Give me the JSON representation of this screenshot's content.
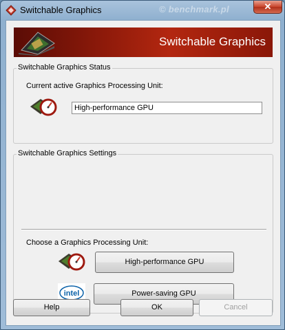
{
  "window": {
    "title": "Switchable Graphics",
    "watermark": "© benchmark.pl",
    "close_glyph": "✕"
  },
  "banner": {
    "title": "Switchable Graphics"
  },
  "status_group": {
    "label": "Switchable Graphics Status",
    "current_label": "Current active Graphics Processing Unit:",
    "current_value": "High-performance GPU"
  },
  "settings_group": {
    "label": "Switchable Graphics Settings",
    "choose_label": "Choose a Graphics Processing Unit:",
    "high_perf_button": "High-performance GPU",
    "power_saving_button": "Power-saving GPU",
    "intel_logo_text": "intel"
  },
  "footer": {
    "help_label": "Help",
    "ok_label": "OK",
    "cancel_label": "Cancel"
  },
  "colors": {
    "banner_red": "#b32710",
    "window_frame": "#9fbcd8",
    "intel_blue": "#0860a8"
  }
}
